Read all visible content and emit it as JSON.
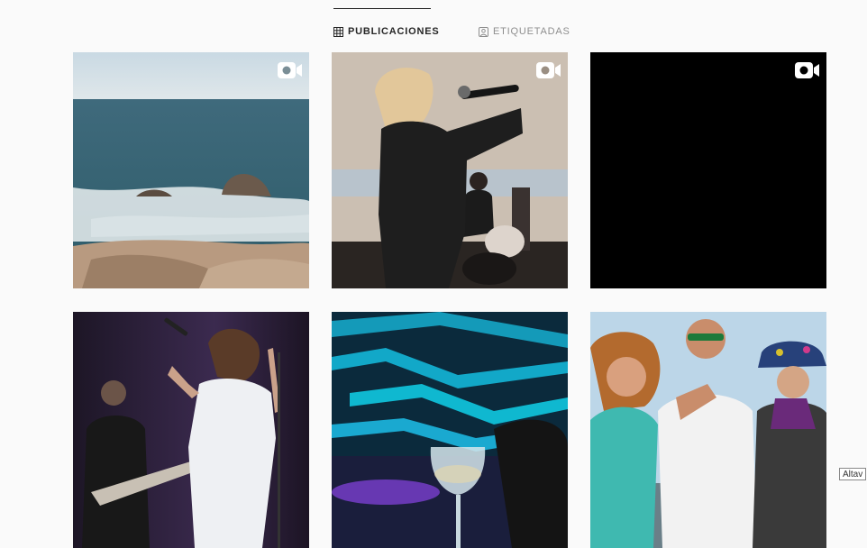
{
  "tabs": {
    "posts_label": "PUBLICACIONES",
    "tagged_label": "ETIQUETADAS",
    "posts_icon": "grid-icon",
    "tagged_icon": "tag-icon"
  },
  "grid": {
    "tiles": [
      {
        "subject": "sea-rocks",
        "video": true
      },
      {
        "subject": "singer-microphone-drums",
        "video": true
      },
      {
        "subject": "black-frame",
        "video": true
      },
      {
        "subject": "singer-stage-guitarist",
        "video": false
      },
      {
        "subject": "neon-ceiling-wine-glass",
        "video": false
      },
      {
        "subject": "group-selfie-beach",
        "video": false
      }
    ],
    "video_icon": "video-camera-icon"
  },
  "tooltip": {
    "text": "Altav"
  },
  "colors": {
    "background": "#fafafa",
    "active_tab": "#262626",
    "inactive_tab": "#8e8e8e"
  }
}
